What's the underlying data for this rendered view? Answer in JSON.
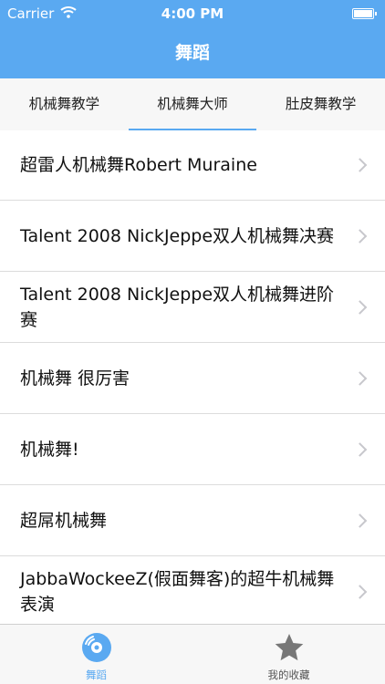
{
  "status_bar": {
    "carrier": "Carrier",
    "time": "4:00 PM"
  },
  "nav": {
    "title": "舞蹈"
  },
  "tabs": [
    {
      "label": "机械舞教学"
    },
    {
      "label": "机械舞大师"
    },
    {
      "label": "肚皮舞教学"
    }
  ],
  "active_tab": 1,
  "list": [
    {
      "title": "超雷人机械舞Robert Muraine"
    },
    {
      "title": "Talent 2008 NickJeppe双人机械舞决赛"
    },
    {
      "title": "Talent 2008 NickJeppe双人机械舞进阶赛"
    },
    {
      "title": "机械舞 很厉害"
    },
    {
      "title": "机械舞!"
    },
    {
      "title": "超屌机械舞"
    },
    {
      "title": "JabbaWockeeZ(假面舞客)的超牛机械舞表演"
    }
  ],
  "tabbar": [
    {
      "label": "舞蹈",
      "icon": "disc-icon",
      "active": true
    },
    {
      "label": "我的收藏",
      "icon": "star-icon",
      "active": false
    }
  ],
  "colors": {
    "accent": "#5aa9f1"
  }
}
